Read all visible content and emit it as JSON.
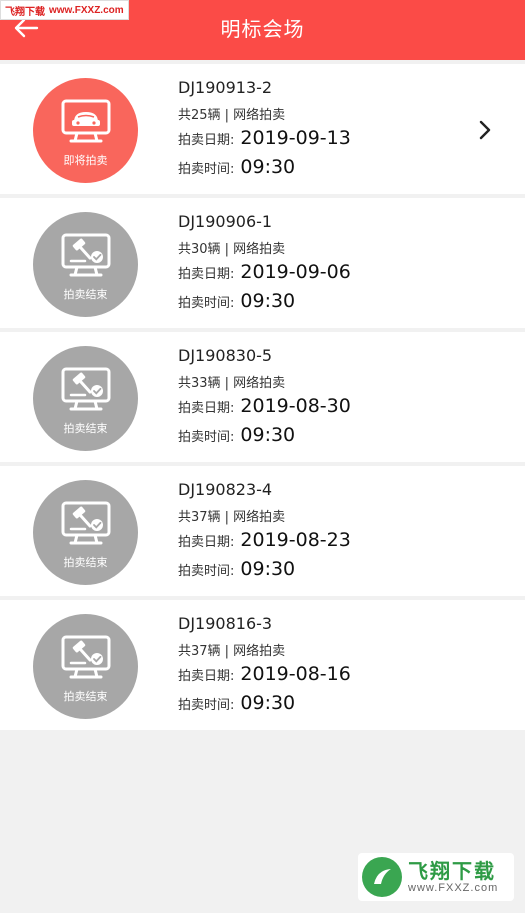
{
  "header": {
    "title": "明标会场",
    "watermark_text": "飞翔下载",
    "watermark_url": "www.FXXZ.com"
  },
  "colors": {
    "accent": "#fb4b47",
    "active_disc": "#f9665c",
    "ended_disc": "#a7a7a7"
  },
  "sessions": [
    {
      "code": "DJ190913-2",
      "meta": "共25辆 | 网络拍卖",
      "date_label": "拍卖日期:",
      "date": "2019-09-13",
      "time_label": "拍卖时间:",
      "time": "09:30",
      "status": "即将拍卖",
      "status_icon": "auction-car-monitor-icon"
    },
    {
      "code": "DJ190906-1",
      "meta": "共30辆 | 网络拍卖",
      "date_label": "拍卖日期:",
      "date": "2019-09-06",
      "time_label": "拍卖时间:",
      "time": "09:30",
      "status": "拍卖结束",
      "status_icon": "gavel-monitor-check-icon"
    },
    {
      "code": "DJ190830-5",
      "meta": "共33辆 | 网络拍卖",
      "date_label": "拍卖日期:",
      "date": "2019-08-30",
      "time_label": "拍卖时间:",
      "time": "09:30",
      "status": "拍卖结束",
      "status_icon": "gavel-monitor-check-icon"
    },
    {
      "code": "DJ190823-4",
      "meta": "共37辆 | 网络拍卖",
      "date_label": "拍卖日期:",
      "date": "2019-08-23",
      "time_label": "拍卖时间:",
      "time": "09:30",
      "status": "拍卖结束",
      "status_icon": "gavel-monitor-check-icon"
    },
    {
      "code": "DJ190816-3",
      "meta": "共37辆 | 网络拍卖",
      "date_label": "拍卖日期:",
      "date": "2019-08-16",
      "time_label": "拍卖时间:",
      "time": "09:30",
      "status": "拍卖结束",
      "status_icon": "gavel-monitor-check-icon"
    }
  ],
  "footer_watermark": {
    "brand": "飞翔下载",
    "site": "www.FXXZ.com"
  }
}
